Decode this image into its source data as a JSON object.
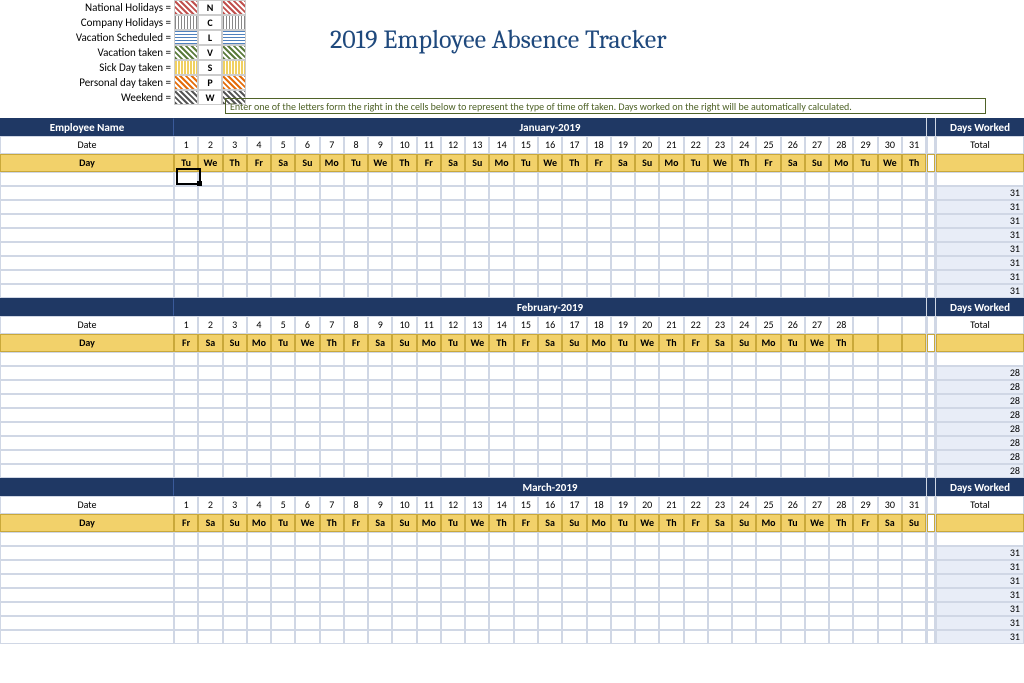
{
  "title": "2019 Employee Absence Tracker",
  "instruction": "Enter one of the letters form the right in the cells below to represent the type of time off taken. Days worked on the right will be automatically calculated.",
  "legend": [
    {
      "label": "National Holidays =",
      "code": "N"
    },
    {
      "label": "Company Holidays =",
      "code": "C"
    },
    {
      "label": "Vacation Scheduled =",
      "code": "L"
    },
    {
      "label": "Vacation taken =",
      "code": "V"
    },
    {
      "label": "Sick Day taken =",
      "code": "S"
    },
    {
      "label": "Personal day taken =",
      "code": "P"
    },
    {
      "label": "Weekend =",
      "code": "W"
    }
  ],
  "employee_header": "Employee Name",
  "date_label": "Date",
  "day_label": "Day",
  "days_worked_label": "Days Worked",
  "total_label": "Total",
  "months": [
    {
      "name": "January-2019",
      "dates": [
        1,
        2,
        3,
        4,
        5,
        6,
        7,
        8,
        9,
        10,
        11,
        12,
        13,
        14,
        15,
        16,
        17,
        18,
        19,
        20,
        21,
        22,
        23,
        24,
        25,
        26,
        27,
        28,
        29,
        30,
        31
      ],
      "days": [
        "Tu",
        "We",
        "Th",
        "Fr",
        "Sa",
        "Su",
        "Mo",
        "Tu",
        "We",
        "Th",
        "Fr",
        "Sa",
        "Su",
        "Mo",
        "Tu",
        "We",
        "Th",
        "Fr",
        "Sa",
        "Su",
        "Mo",
        "Tu",
        "We",
        "Th",
        "Fr",
        "Sa",
        "Su",
        "Mo",
        "Tu",
        "We",
        "Th"
      ],
      "rows": 8,
      "days_worked": 31
    },
    {
      "name": "February-2019",
      "dates": [
        1,
        2,
        3,
        4,
        5,
        6,
        7,
        8,
        9,
        10,
        11,
        12,
        13,
        14,
        15,
        16,
        17,
        18,
        19,
        20,
        21,
        22,
        23,
        24,
        25,
        26,
        27,
        28
      ],
      "days": [
        "Fr",
        "Sa",
        "Su",
        "Mo",
        "Tu",
        "We",
        "Th",
        "Fr",
        "Sa",
        "Su",
        "Mo",
        "Tu",
        "We",
        "Th",
        "Fr",
        "Sa",
        "Su",
        "Mo",
        "Tu",
        "We",
        "Th",
        "Fr",
        "Sa",
        "Su",
        "Mo",
        "Tu",
        "We",
        "Th"
      ],
      "rows": 8,
      "days_worked": 28
    },
    {
      "name": "March-2019",
      "dates": [
        1,
        2,
        3,
        4,
        5,
        6,
        7,
        8,
        9,
        10,
        11,
        12,
        13,
        14,
        15,
        16,
        17,
        18,
        19,
        20,
        21,
        22,
        23,
        24,
        25,
        26,
        27,
        28,
        29,
        30,
        31
      ],
      "days": [
        "Fr",
        "Sa",
        "Su",
        "Mo",
        "Tu",
        "We",
        "Th",
        "Fr",
        "Sa",
        "Su",
        "Mo",
        "Tu",
        "We",
        "Th",
        "Fr",
        "Sa",
        "Su",
        "Mo",
        "Tu",
        "We",
        "Th",
        "Fr",
        "Sa",
        "Su",
        "Mo",
        "Tu",
        "We",
        "Th",
        "Fr",
        "Sa",
        "Su"
      ],
      "rows": 7,
      "days_worked": 31
    }
  ]
}
